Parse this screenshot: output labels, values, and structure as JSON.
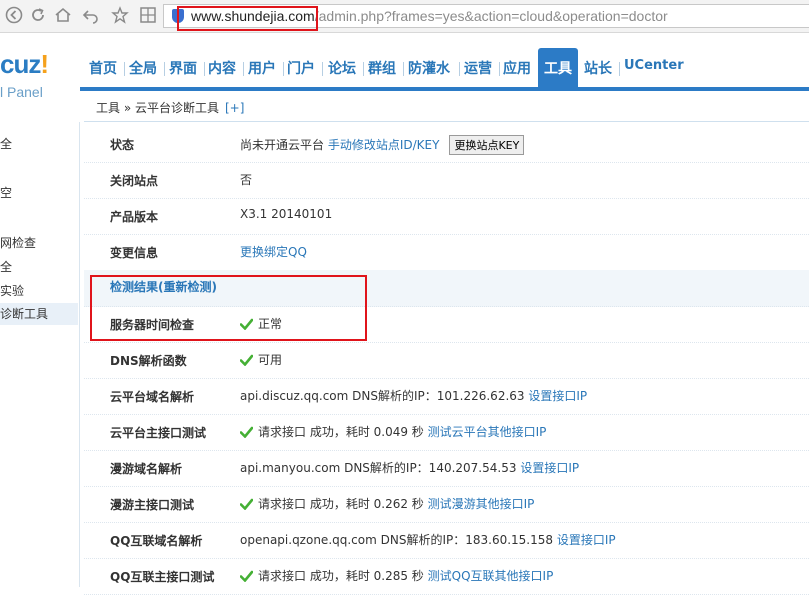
{
  "browser": {
    "url_domain": "www.shundejia.com",
    "url_rest": "/admin.php?frames=yes&action=cloud&operation=doctor",
    "icons": [
      "back-icon",
      "refresh-icon",
      "home-icon",
      "undo-icon",
      "star-icon",
      "grid-icon",
      "shield-icon"
    ]
  },
  "brand": {
    "logo_text": "cuz",
    "logo_bang": "!",
    "subtitle": "l Panel"
  },
  "nav": {
    "items": [
      "首页",
      "全局",
      "界面",
      "内容",
      "用户",
      "门户",
      "论坛",
      "群组",
      "防灌水",
      "运营",
      "应用"
    ],
    "active": "工具",
    "after": [
      "站长",
      "UCenter"
    ]
  },
  "breadcrumb": {
    "text": "工具 » 云平台诊断工具",
    "plus": "[+]"
  },
  "sidebar": {
    "items": [
      "全",
      "",
      "空",
      "",
      "网检查",
      "全",
      "实验",
      "诊断工具"
    ]
  },
  "table": {
    "status_label": "状态",
    "status_value": "尚未开通云平台",
    "status_link": "手动修改站点ID/KEY",
    "status_button": "更换站点KEY",
    "closed_label": "关闭站点",
    "closed_value": "否",
    "version_label": "产品版本",
    "version_value": "X3.1 20140101",
    "change_label": "变更信息",
    "change_link": "更换绑定QQ",
    "section_label": "检测结果(重新检测)",
    "time_label": "服务器时间检查",
    "time_value": "正常",
    "dns_label": "DNS解析函数",
    "dns_value": "可用",
    "cloud_dns_label": "云平台域名解析",
    "cloud_dns_value": "api.discuz.qq.com DNS解析的IP：101.226.62.63",
    "cloud_dns_link": "设置接口IP",
    "cloud_api_label": "云平台主接口测试",
    "cloud_api_value": "请求接口 成功，耗时 0.049 秒",
    "cloud_api_link": "测试云平台其他接口IP",
    "manyou_dns_label": "漫游域名解析",
    "manyou_dns_value": "api.manyou.com DNS解析的IP：140.207.54.53",
    "manyou_dns_link": "设置接口IP",
    "manyou_api_label": "漫游主接口测试",
    "manyou_api_value": "请求接口 成功，耗时 0.262 秒",
    "manyou_api_link": "测试漫游其他接口IP",
    "qq_dns_label": "QQ互联域名解析",
    "qq_dns_value": "openapi.qzone.qq.com DNS解析的IP：183.60.15.158",
    "qq_dns_link": "设置接口IP",
    "qq_api_label": "QQ互联主接口测试",
    "qq_api_value": "请求接口 成功，耗时 0.285 秒",
    "qq_api_link": "测试QQ互联其他接口IP"
  },
  "colors": {
    "accent": "#2c7bc6",
    "link": "#2a77b8",
    "highlight": "#e0141b",
    "check": "#45b035"
  }
}
